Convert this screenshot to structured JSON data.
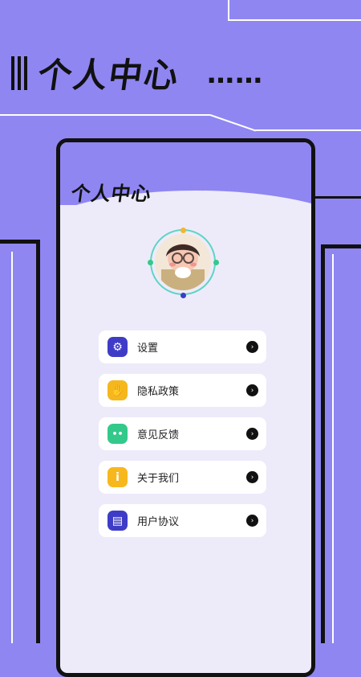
{
  "header": {
    "title": "个人中心",
    "dots": "……"
  },
  "phone": {
    "title": "个人中心"
  },
  "menu": [
    {
      "label": "设置",
      "icon": "gear-icon",
      "color": "#3e3cc7",
      "glyph": "⚙"
    },
    {
      "label": "隐私政策",
      "icon": "hand-icon",
      "color": "#f5b71d",
      "glyph": "✋"
    },
    {
      "label": "意见反馈",
      "icon": "chat-icon",
      "color": "#33c98a",
      "glyph": "••"
    },
    {
      "label": "关于我们",
      "icon": "info-icon",
      "color": "#f7b81e",
      "glyph": "i"
    },
    {
      "label": "用户协议",
      "icon": "document-icon",
      "color": "#3e3cc7",
      "glyph": "▤"
    }
  ],
  "colors": {
    "background": "#8f86f2",
    "card": "#edebfa",
    "ring": "#5fd4c2"
  }
}
